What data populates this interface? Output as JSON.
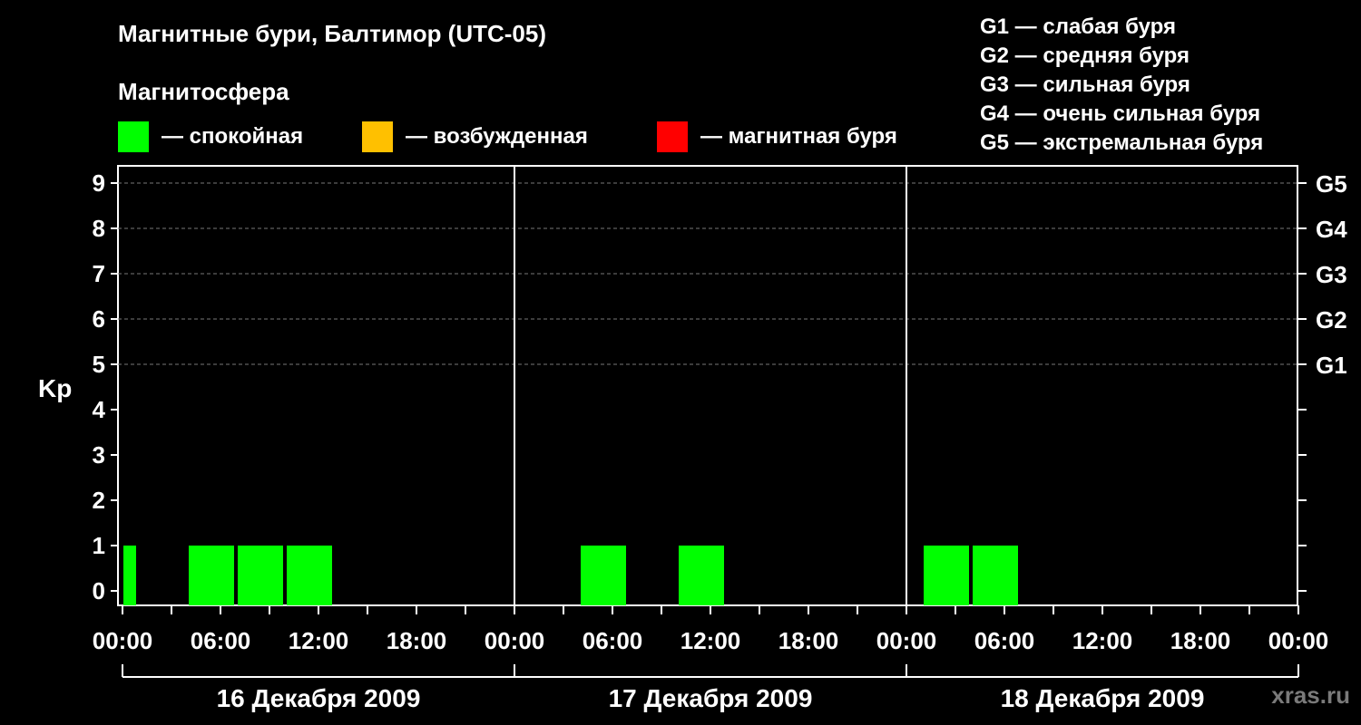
{
  "title": "Магнитные бури, Балтимор (UTC-05)",
  "subtitle": "Магнитосфера",
  "legend": [
    {
      "label": "— спокойная",
      "color": "#00ff00"
    },
    {
      "label": "— возбужденная",
      "color": "#ffc000"
    },
    {
      "label": "— магнитная буря",
      "color": "#ff0000"
    }
  ],
  "g_legend": [
    "G1 — слабая буря",
    "G2 — средняя буря",
    "G3 — сильная буря",
    "G4 — очень сильная буря",
    "G5 — экстремальная буря"
  ],
  "watermark": "xras.ru",
  "chart_data": {
    "type": "bar",
    "ylabel": "Kp",
    "ylim": [
      0,
      9
    ],
    "yticks": [
      "0",
      "1",
      "2",
      "3",
      "4",
      "5",
      "6",
      "7",
      "8",
      "9"
    ],
    "right_ticks": [
      {
        "kp": 5,
        "label": "G1"
      },
      {
        "kp": 6,
        "label": "G2"
      },
      {
        "kp": 7,
        "label": "G3"
      },
      {
        "kp": 8,
        "label": "G4"
      },
      {
        "kp": 9,
        "label": "G5"
      }
    ],
    "xticks": [
      "00:00",
      "06:00",
      "12:00",
      "18:00",
      "00:00",
      "06:00",
      "12:00",
      "18:00",
      "00:00",
      "06:00",
      "12:00",
      "18:00",
      "00:00"
    ],
    "days": [
      "16 Декабря 2009",
      "17 Декабря 2009",
      "18 Декабря 2009"
    ],
    "grid": true,
    "bars": [
      {
        "day": 0,
        "start_hour": 0,
        "end_hour": 1,
        "kp": 1,
        "color": "#00ff00"
      },
      {
        "day": 0,
        "start_hour": 4,
        "end_hour": 7,
        "kp": 1,
        "color": "#00ff00"
      },
      {
        "day": 0,
        "start_hour": 7,
        "end_hour": 10,
        "kp": 1,
        "color": "#00ff00"
      },
      {
        "day": 0,
        "start_hour": 10,
        "end_hour": 13,
        "kp": 1,
        "color": "#00ff00"
      },
      {
        "day": 1,
        "start_hour": 4,
        "end_hour": 7,
        "kp": 1,
        "color": "#00ff00"
      },
      {
        "day": 1,
        "start_hour": 10,
        "end_hour": 13,
        "kp": 1,
        "color": "#00ff00"
      },
      {
        "day": 2,
        "start_hour": 1,
        "end_hour": 4,
        "kp": 1,
        "color": "#00ff00"
      },
      {
        "day": 2,
        "start_hour": 4,
        "end_hour": 7,
        "kp": 1,
        "color": "#00ff00"
      }
    ]
  }
}
